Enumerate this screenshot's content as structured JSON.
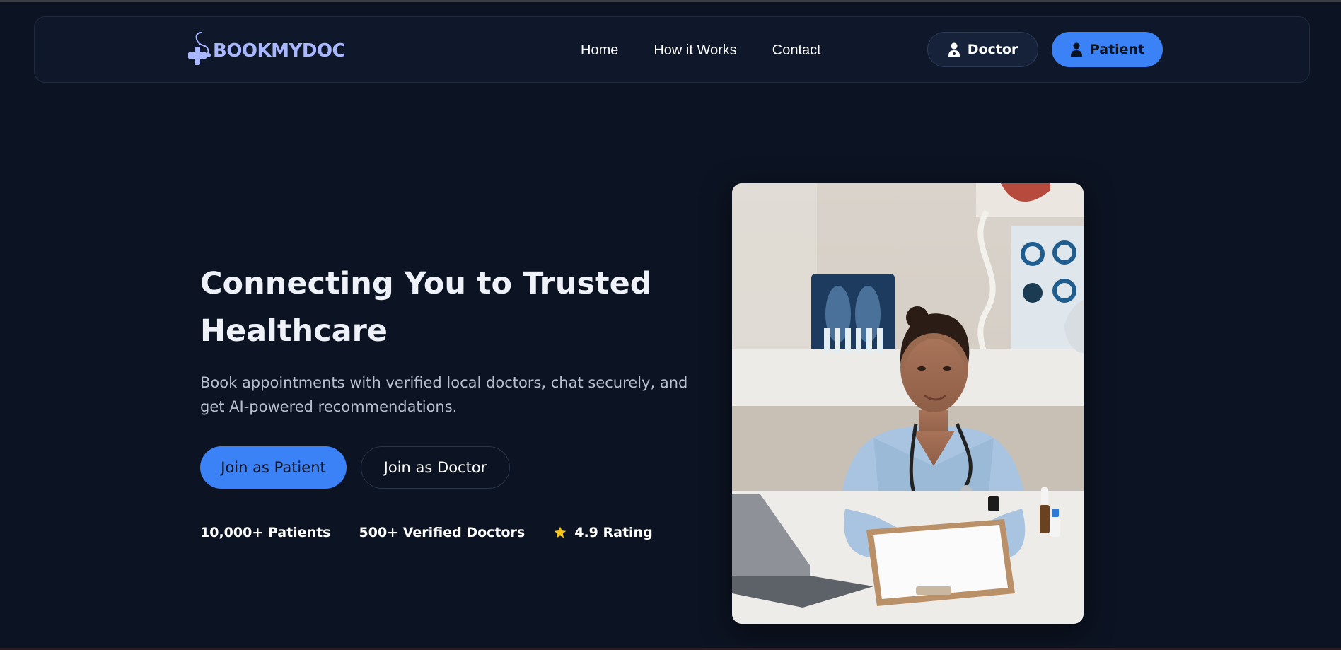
{
  "brand": {
    "name": "BOOKMYDOC",
    "logo_icon": "medical-cross-stethoscope-icon",
    "color": "#a9b7ff"
  },
  "nav": {
    "links": [
      "Home",
      "How it Works",
      "Contact"
    ],
    "doctor_button": {
      "label": "Doctor",
      "icon": "doctor-icon"
    },
    "patient_button": {
      "label": "Patient",
      "icon": "user-icon"
    }
  },
  "hero": {
    "title": "Connecting You to Trusted Healthcare",
    "subtitle": "Book appointments with verified local doctors, chat securely, and get AI-powered recommendations.",
    "cta_patient": "Join as Patient",
    "cta_doctor": "Join as Doctor",
    "stats": [
      {
        "text": "10,000+ Patients"
      },
      {
        "text": "500+ Verified Doctors"
      },
      {
        "text": "4.9 Rating",
        "icon": "star-icon"
      }
    ]
  },
  "colors": {
    "accent": "#3b82f6",
    "background": "#0c1322",
    "star": "#f5c518"
  }
}
